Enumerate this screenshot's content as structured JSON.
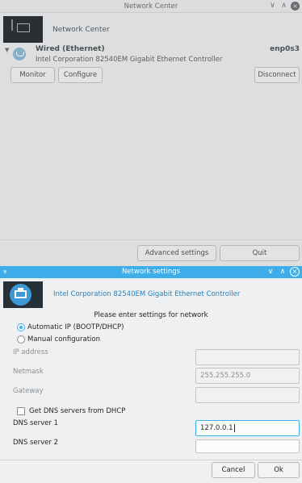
{
  "background_window": {
    "title": "Network Center",
    "app_title": "Network Center",
    "connection": {
      "name": "Wired (Ethernet)",
      "device": "Intel Corporation 82540EM Gigabit Ethernet Controller",
      "interface": "enp0s3"
    },
    "buttons": {
      "monitor": "Monitor",
      "configure": "Configure",
      "disconnect": "Disconnect",
      "advanced": "Advanced settings",
      "quit": "Quit"
    },
    "controls": {
      "minimize": "∨",
      "maximize": "∧",
      "close": "×"
    }
  },
  "dialog": {
    "title": "Network settings",
    "device_title": "Intel Corporation 82540EM Gigabit Ethernet Controller",
    "prompt": "Please enter settings for network",
    "radio_auto": "Automatic IP (BOOTP/DHCP)",
    "radio_manual": "Manual configuration",
    "selected_mode": "Automatic IP (BOOTP/DHCP)",
    "fields": {
      "ip_label": "IP address",
      "ip_value": "",
      "netmask_label": "Netmask",
      "netmask_value": "255.255.255.0",
      "gateway_label": "Gateway",
      "gateway_value": "",
      "dns1_label": "DNS server 1",
      "dns1_value": "127.0.0.1",
      "dns2_label": "DNS server 2",
      "dns2_value": ""
    },
    "dns_from_dhcp_label": "Get DNS servers from DHCP",
    "dns_from_dhcp_checked": false,
    "buttons": {
      "cancel": "Cancel",
      "ok": "Ok"
    },
    "controls": {
      "minimize": "∨",
      "maximize": "∧",
      "close": "×"
    }
  },
  "colors": {
    "accent": "#3daee9",
    "link": "#2980b9"
  }
}
